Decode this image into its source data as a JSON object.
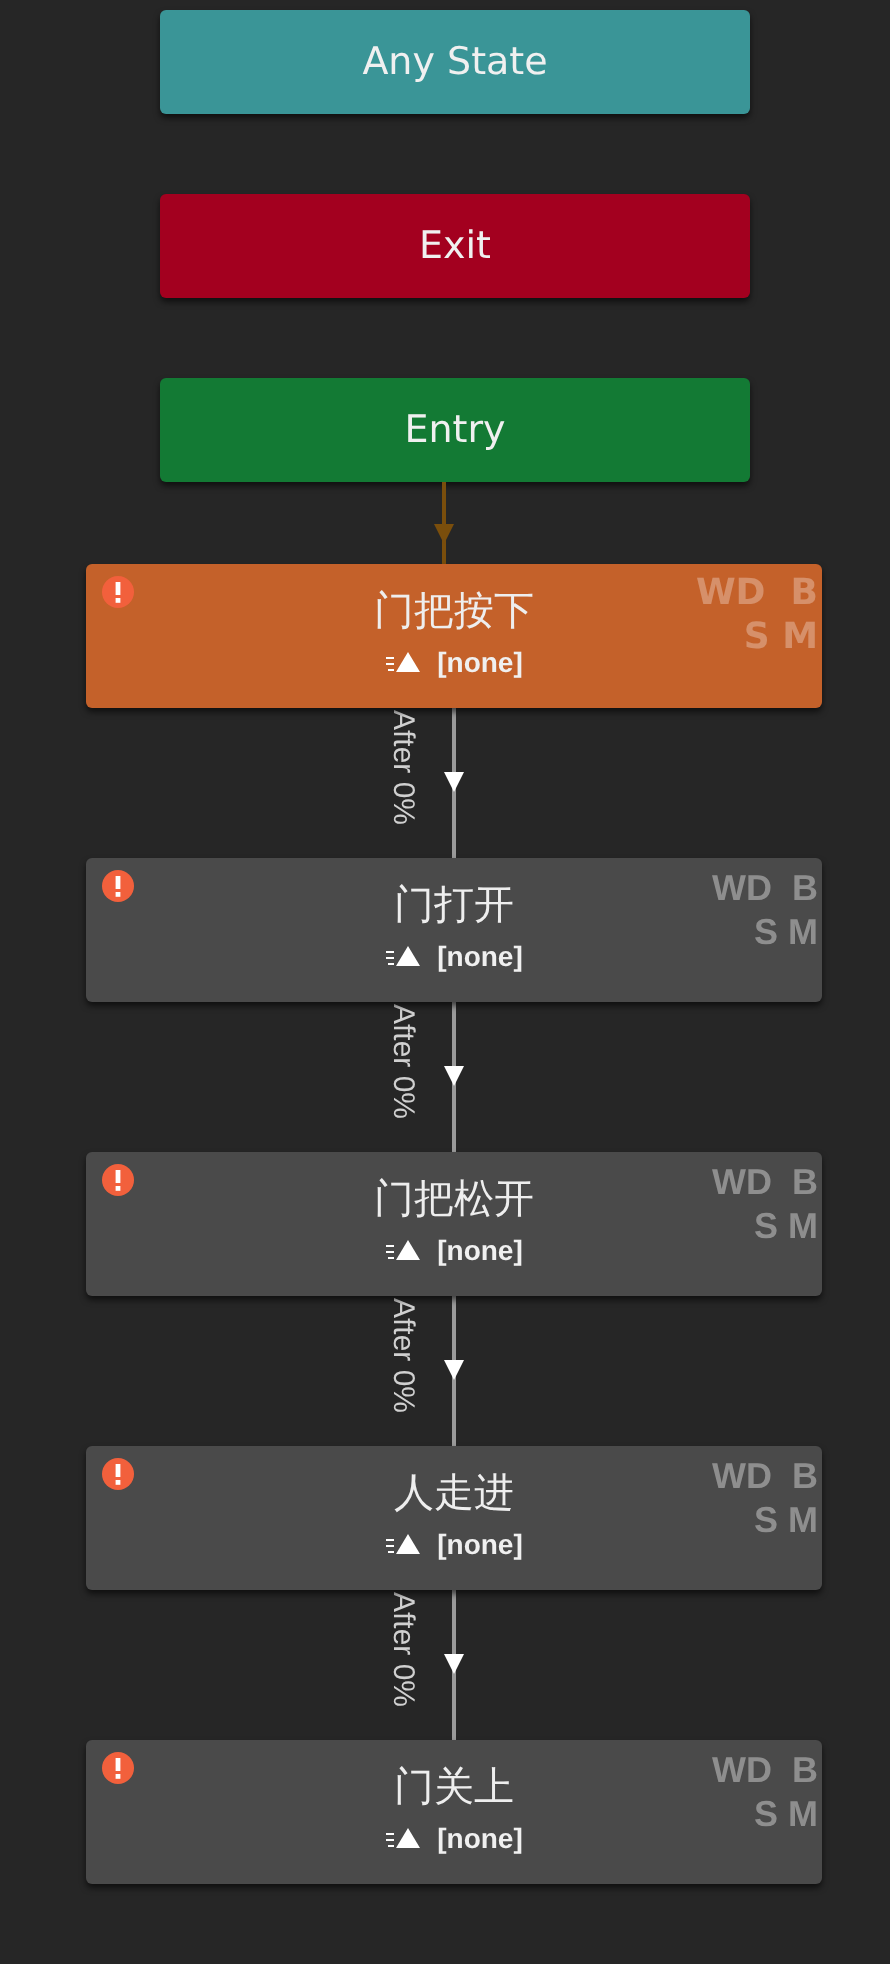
{
  "special_nodes": [
    {
      "label": "Any State",
      "kind": "any"
    },
    {
      "label": "Exit",
      "kind": "exit"
    },
    {
      "label": "Entry",
      "kind": "entry"
    }
  ],
  "states": [
    {
      "name": "门把按下",
      "kind": "default",
      "warning": true,
      "motion": "[none]",
      "flags_line_1": "WD  B",
      "flags_line_2": "S M"
    },
    {
      "name": "门打开",
      "kind": "normal",
      "warning": true,
      "motion": "[none]",
      "flags_line_1": "WD  B",
      "flags_line_2": "S M"
    },
    {
      "name": "门把松开",
      "kind": "normal",
      "warning": true,
      "motion": "[none]",
      "flags_line_1": "WD  B",
      "flags_line_2": "S M"
    },
    {
      "name": "人走进",
      "kind": "normal",
      "warning": true,
      "motion": "[none]",
      "flags_line_1": "WD  B",
      "flags_line_2": "S M"
    },
    {
      "name": "门关上",
      "kind": "normal",
      "warning": true,
      "motion": "[none]",
      "flags_line_1": "WD  B",
      "flags_line_2": "S M"
    }
  ],
  "transitions": [
    {
      "label": "After 0%"
    },
    {
      "label": "After 0%"
    },
    {
      "label": "After 0%"
    },
    {
      "label": "After 0%"
    }
  ]
}
